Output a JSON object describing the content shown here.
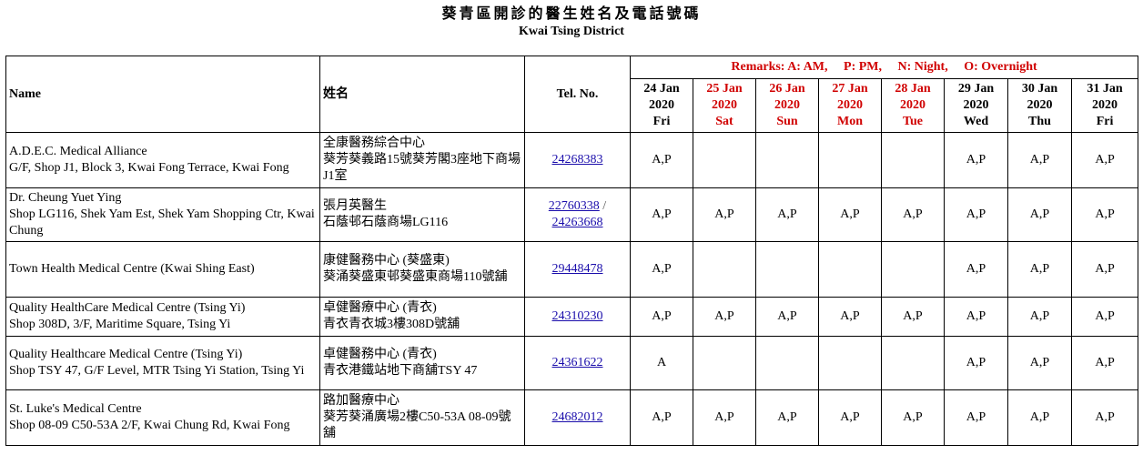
{
  "title": {
    "zh": "葵青區開診的醫生姓名及電話號碼",
    "en": "Kwai Tsing District"
  },
  "headers": {
    "name": "Name",
    "name_zh": "姓名",
    "tel": "Tel. No.",
    "remarks": "Remarks: A: AM,     P: PM,     N: Night,     O: Overnight"
  },
  "dates": [
    {
      "day": "24 Jan",
      "year": "2020",
      "weekday": "Fri",
      "holiday": false
    },
    {
      "day": "25 Jan",
      "year": "2020",
      "weekday": "Sat",
      "holiday": true
    },
    {
      "day": "26 Jan",
      "year": "2020",
      "weekday": "Sun",
      "holiday": true
    },
    {
      "day": "27 Jan",
      "year": "2020",
      "weekday": "Mon",
      "holiday": true
    },
    {
      "day": "28 Jan",
      "year": "2020",
      "weekday": "Tue",
      "holiday": true
    },
    {
      "day": "29 Jan",
      "year": "2020",
      "weekday": "Wed",
      "holiday": false
    },
    {
      "day": "30 Jan",
      "year": "2020",
      "weekday": "Thu",
      "holiday": false
    },
    {
      "day": "31 Jan",
      "year": "2020",
      "weekday": "Fri",
      "holiday": false
    }
  ],
  "rows": [
    {
      "name": "A.D.E.C. Medical Alliance",
      "address": "G/F, Shop J1, Block 3, Kwai Fong Terrace, Kwai Fong",
      "name_zh": "全康醫務綜合中心",
      "address_zh": "葵芳葵義路15號葵芳閣3座地下商場J1室",
      "tel": [
        "24268383"
      ],
      "sessions": [
        "A,P",
        "",
        "",
        "",
        "",
        "A,P",
        "A,P",
        "A,P"
      ]
    },
    {
      "name": "Dr. Cheung Yuet Ying",
      "address": "Shop LG116, Shek Yam Est, Shek Yam Shopping Ctr, Kwai Chung",
      "name_zh": "張月英醫生",
      "address_zh": "石蔭邨石蔭商場LG116",
      "tel": [
        "22760338",
        "24263668"
      ],
      "sessions": [
        "A,P",
        "A,P",
        "A,P",
        "A,P",
        "A,P",
        "A,P",
        "A,P",
        "A,P"
      ]
    },
    {
      "name": "Town Health Medical Centre (Kwai Shing East)",
      "address": "",
      "name_zh": "康健醫務中心 (葵盛東)",
      "address_zh": "葵涌葵盛東邨葵盛東商場110號舖",
      "tel": [
        "29448478"
      ],
      "sessions": [
        "A,P",
        "",
        "",
        "",
        "",
        "A,P",
        "A,P",
        "A,P"
      ]
    },
    {
      "name": "Quality HealthCare Medical Centre (Tsing Yi)",
      "address": "Shop 308D, 3/F, Maritime Square, Tsing Yi",
      "name_zh": "卓健醫療中心 (青衣)",
      "address_zh": "青衣青衣城3樓308D號舖",
      "tel": [
        "24310230"
      ],
      "sessions": [
        "A,P",
        "A,P",
        "A,P",
        "A,P",
        "A,P",
        "A,P",
        "A,P",
        "A,P"
      ]
    },
    {
      "name": "Quality Healthcare Medical Centre (Tsing Yi)",
      "address": "Shop TSY 47, G/F Level, MTR Tsing Yi Station, Tsing Yi",
      "name_zh": "卓健醫務中心 (青衣)",
      "address_zh": "青衣港鐵站地下商舖TSY 47",
      "tel": [
        "24361622"
      ],
      "sessions": [
        "A",
        "",
        "",
        "",
        "",
        "A,P",
        "A,P",
        "A,P"
      ]
    },
    {
      "name": "St. Luke's Medical Centre",
      "address": "Shop 08-09 C50-53A 2/F, Kwai Chung Rd, Kwai Fong",
      "name_zh": "路加醫療中心",
      "address_zh": "葵芳葵涌廣場2樓C50-53A 08-09號舖",
      "tel": [
        "24682012"
      ],
      "sessions": [
        "A,P",
        "A,P",
        "A,P",
        "A,P",
        "A,P",
        "A,P",
        "A,P",
        "A,P"
      ]
    }
  ],
  "colors": {
    "holiday": "#d00000",
    "link": "#1a0dab"
  }
}
